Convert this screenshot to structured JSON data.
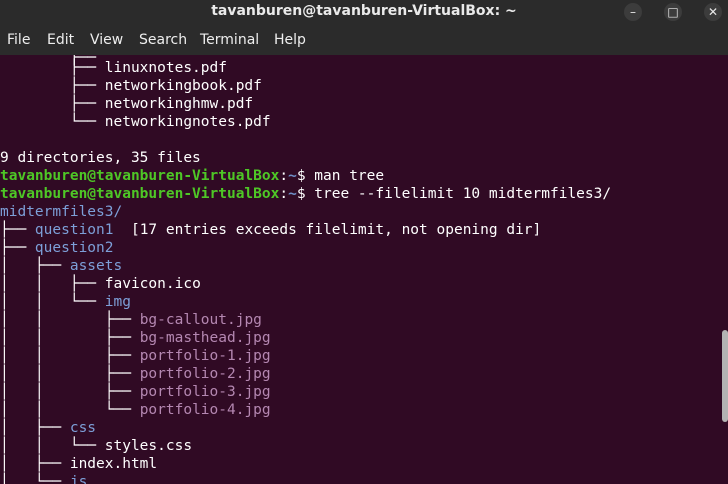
{
  "window": {
    "title": "tavanburen@tavanburen-VirtualBox: ~",
    "controls": [
      "–",
      "□",
      "✕"
    ]
  },
  "menu": [
    "File",
    "Edit",
    "View",
    "Search",
    "Terminal",
    "Help"
  ],
  "terminal": {
    "lines": [
      {
        "text": "        ├── linuxnotes.pdf"
      },
      {
        "text": "        ├── networkingbook.pdf"
      },
      {
        "text": "        ├── networkinghmw.pdf"
      },
      {
        "text": "        └── networkingnotes.pdf"
      },
      {
        "text": ""
      },
      {
        "text": "9 directories, 35 files"
      },
      {
        "user": "tavanburen@tavanburen-VirtualBox",
        "path": "~",
        "cmd": "$ man tree"
      },
      {
        "user": "tavanburen@tavanburen-VirtualBox",
        "path": "~",
        "cmd": "$ tree --filelimit 10 midtermfiles3/"
      },
      {
        "dir": "midtermfiles3/"
      },
      {
        "prefix": "├── ",
        "dir": "question1",
        "text": "  [17 entries exceeds filelimit, not opening dir]"
      },
      {
        "prefix": "├── ",
        "dir": "question2"
      },
      {
        "prefix": "│   ├── ",
        "dir": "assets"
      },
      {
        "prefix": "│   │   ├── ",
        "text": "favicon.ico"
      },
      {
        "prefix": "│   │   └── ",
        "dir": "img"
      },
      {
        "prefix": "│   │       ├── ",
        "img": "bg-callout.jpg"
      },
      {
        "prefix": "│   │       ├── ",
        "img": "bg-masthead.jpg"
      },
      {
        "prefix": "│   │       ├── ",
        "img": "portfolio-1.jpg"
      },
      {
        "prefix": "│   │       ├── ",
        "img": "portfolio-2.jpg"
      },
      {
        "prefix": "│   │       ├── ",
        "img": "portfolio-3.jpg"
      },
      {
        "prefix": "│   │       └── ",
        "img": "portfolio-4.jpg"
      },
      {
        "prefix": "│   ├── ",
        "dir": "css"
      },
      {
        "prefix": "│   │   └── ",
        "text": "styles.css"
      },
      {
        "prefix": "│   ├── ",
        "text": "index.html"
      },
      {
        "prefix": "│   └── ",
        "dir": "js"
      }
    ]
  }
}
